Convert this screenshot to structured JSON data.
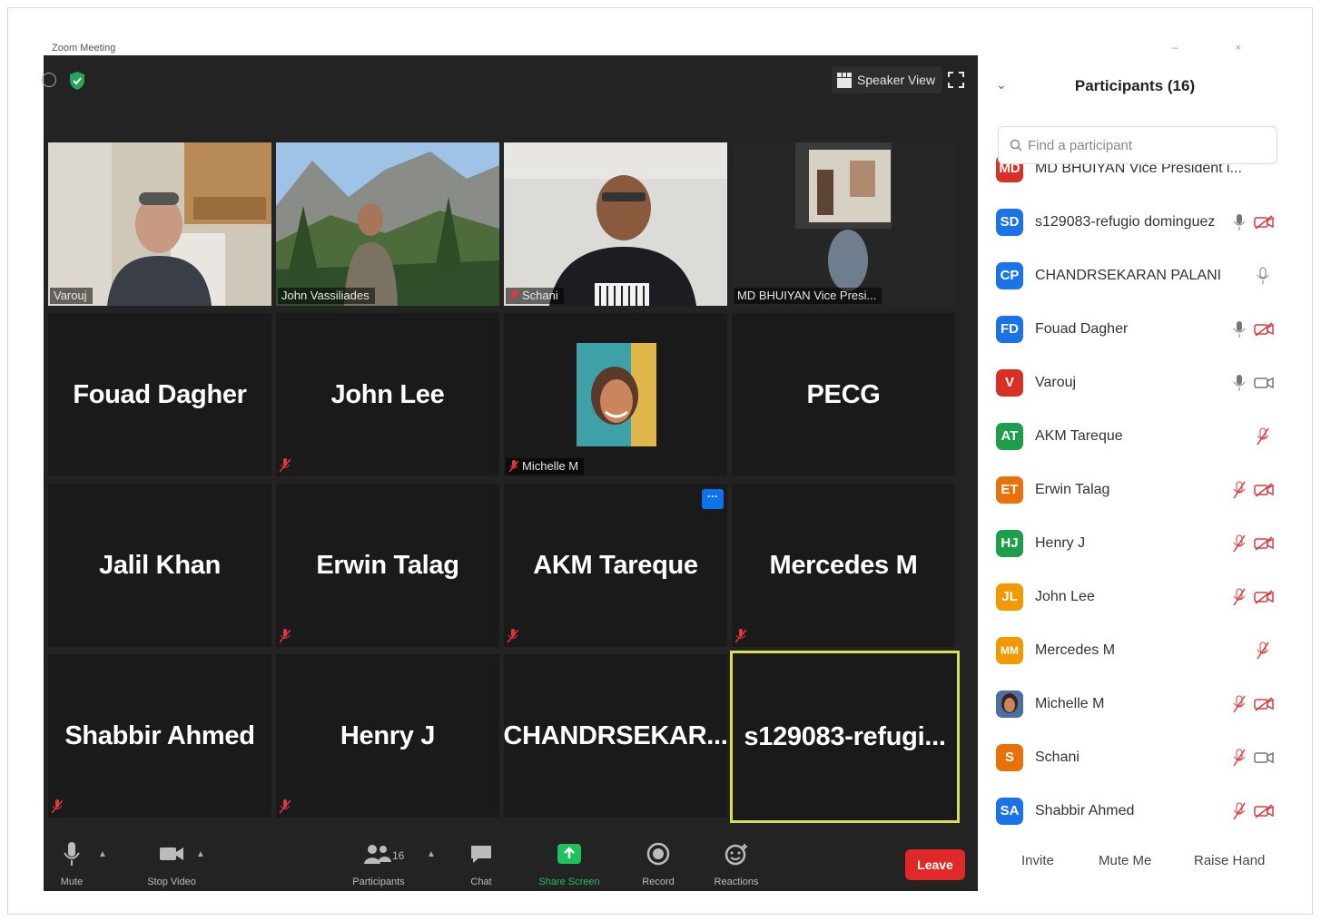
{
  "window": {
    "title": "Zoom Meeting"
  },
  "topbar": {
    "speaker_view_label": "Speaker View"
  },
  "video_tiles": [
    {
      "label": "Varouj",
      "muted": false
    },
    {
      "label": "John Vassiliades",
      "muted": false
    },
    {
      "label": "Schani",
      "muted": true
    },
    {
      "label": "MD BHUIYAN  Vice Presi...",
      "muted": false
    }
  ],
  "name_tiles": [
    {
      "name": "Fouad Dagher",
      "muted": false
    },
    {
      "name": "John Lee",
      "muted": true
    },
    {
      "name": "Michelle M",
      "muted": true
    },
    {
      "name": "PECG",
      "muted": false
    },
    {
      "name": "Jalil Khan",
      "muted": false
    },
    {
      "name": "Erwin Talag",
      "muted": true
    },
    {
      "name": "AKM Tareque",
      "muted": true
    },
    {
      "name": "Mercedes M",
      "muted": true
    },
    {
      "name": "Shabbir Ahmed",
      "muted": true
    },
    {
      "name": "Henry J",
      "muted": true
    },
    {
      "name": "CHANDRSEKAR...",
      "muted": false
    },
    {
      "name": "s129083-refugi...",
      "muted": false
    }
  ],
  "toolbar": {
    "mute_label": "Mute",
    "stop_video_label": "Stop Video",
    "participants_label": "Participants",
    "participants_count": "16",
    "chat_label": "Chat",
    "share_screen_label": "Share Screen",
    "record_label": "Record",
    "reactions_label": "Reactions",
    "leave_label": "Leave"
  },
  "panel": {
    "title": "Participants (16)",
    "search_placeholder": "Find a participant",
    "participants": [
      {
        "initials": "MD",
        "name": "MD BHUIYAN  Vice President i...",
        "color": "#d93025"
      },
      {
        "initials": "SD",
        "name": "s129083-refugio dominguez",
        "color": "#1a73e8"
      },
      {
        "initials": "CP",
        "name": "CHANDRSEKARAN PALANI",
        "color": "#1a73e8"
      },
      {
        "initials": "FD",
        "name": "Fouad Dagher",
        "color": "#1a73e8"
      },
      {
        "initials": "V",
        "name": "Varouj",
        "color": "#d93025"
      },
      {
        "initials": "AT",
        "name": "AKM Tareque",
        "color": "#1e9e4a"
      },
      {
        "initials": "ET",
        "name": "Erwin Talag",
        "color": "#e8710a"
      },
      {
        "initials": "HJ",
        "name": "Henry J",
        "color": "#1e9e4a"
      },
      {
        "initials": "JL",
        "name": "John Lee",
        "color": "#f29900"
      },
      {
        "initials": "MM",
        "name": "Mercedes M",
        "color": "#f29900"
      },
      {
        "initials": "",
        "name": "Michelle M",
        "color": "#7b5e57"
      },
      {
        "initials": "S",
        "name": "Schani",
        "color": "#e8710a"
      },
      {
        "initials": "SA",
        "name": "Shabbir Ahmed",
        "color": "#1a73e8"
      }
    ],
    "invite_label": "Invite",
    "mute_me_label": "Mute Me",
    "raise_hand_label": "Raise Hand"
  },
  "colors": {
    "accent_green": "#1e9e4a",
    "leave_red": "#e02828",
    "active_outline": "#d5e04a",
    "muted_red": "#e0383e"
  }
}
